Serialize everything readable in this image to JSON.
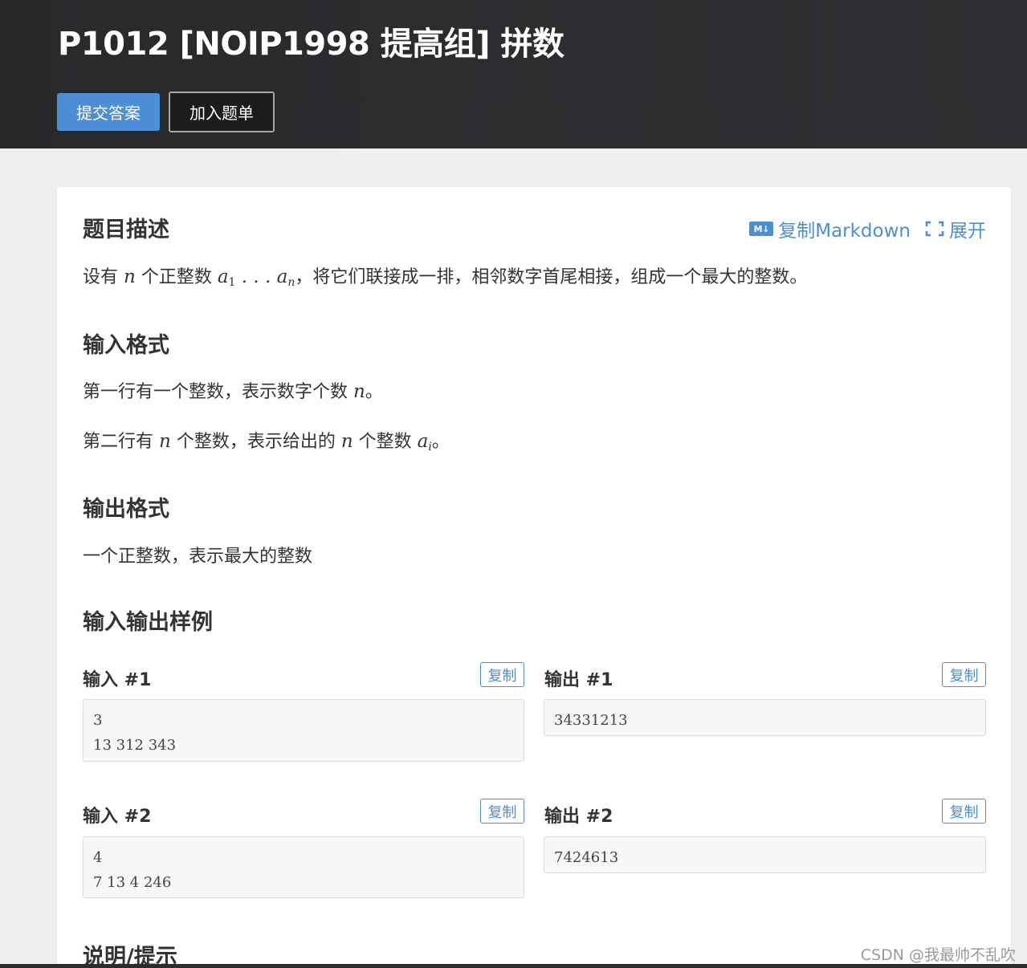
{
  "header": {
    "title": "P1012 [NOIP1998 提高组] 拼数",
    "submit_label": "提交答案",
    "add_list_label": "加入题单"
  },
  "toolbar": {
    "copy_markdown_icon": "markdown-icon",
    "copy_markdown_label": "复制Markdown",
    "expand_icon": "expand-icon",
    "expand_label": "展开"
  },
  "description": {
    "heading": "题目描述",
    "text_1": "设有 ",
    "math_n": "n",
    "text_2": " 个正整数 ",
    "math_a": "a",
    "sub_1": "1",
    "math_dots": " . . . ",
    "math_a2": "a",
    "sub_n": "n",
    "text_3": "，将它们联接成一排，相邻数字首尾相接，组成一个最大的整数。"
  },
  "input_format": {
    "heading": "输入格式",
    "line1_text": "第一行有一个整数，表示数字个数 ",
    "line1_math": "n",
    "line1_end": "。",
    "line2_text1": "第二行有 ",
    "line2_math1": "n",
    "line2_text2": " 个整数，表示给出的 ",
    "line2_math2": "n",
    "line2_text3": " 个整数 ",
    "line2_math3": "a",
    "line2_sub": "i",
    "line2_end": "。"
  },
  "output_format": {
    "heading": "输出格式",
    "text": "一个正整数，表示最大的整数"
  },
  "samples": {
    "heading": "输入输出样例",
    "copy_label": "复制",
    "items": [
      {
        "in_label": "输入 #1",
        "in_text": "3\n13 312 343",
        "out_label": "输出 #1",
        "out_text": "34331213"
      },
      {
        "in_label": "输入 #2",
        "in_text": "4\n7 13 4 246",
        "out_label": "输出 #2",
        "out_text": "7424613"
      }
    ]
  },
  "hint": {
    "heading": "说明/提示"
  },
  "watermark": "CSDN @我最帅不乱吹",
  "colors": {
    "header_bg": "#2c2d2f",
    "accent": "#4d8fd6",
    "page_bg": "#efefef"
  }
}
